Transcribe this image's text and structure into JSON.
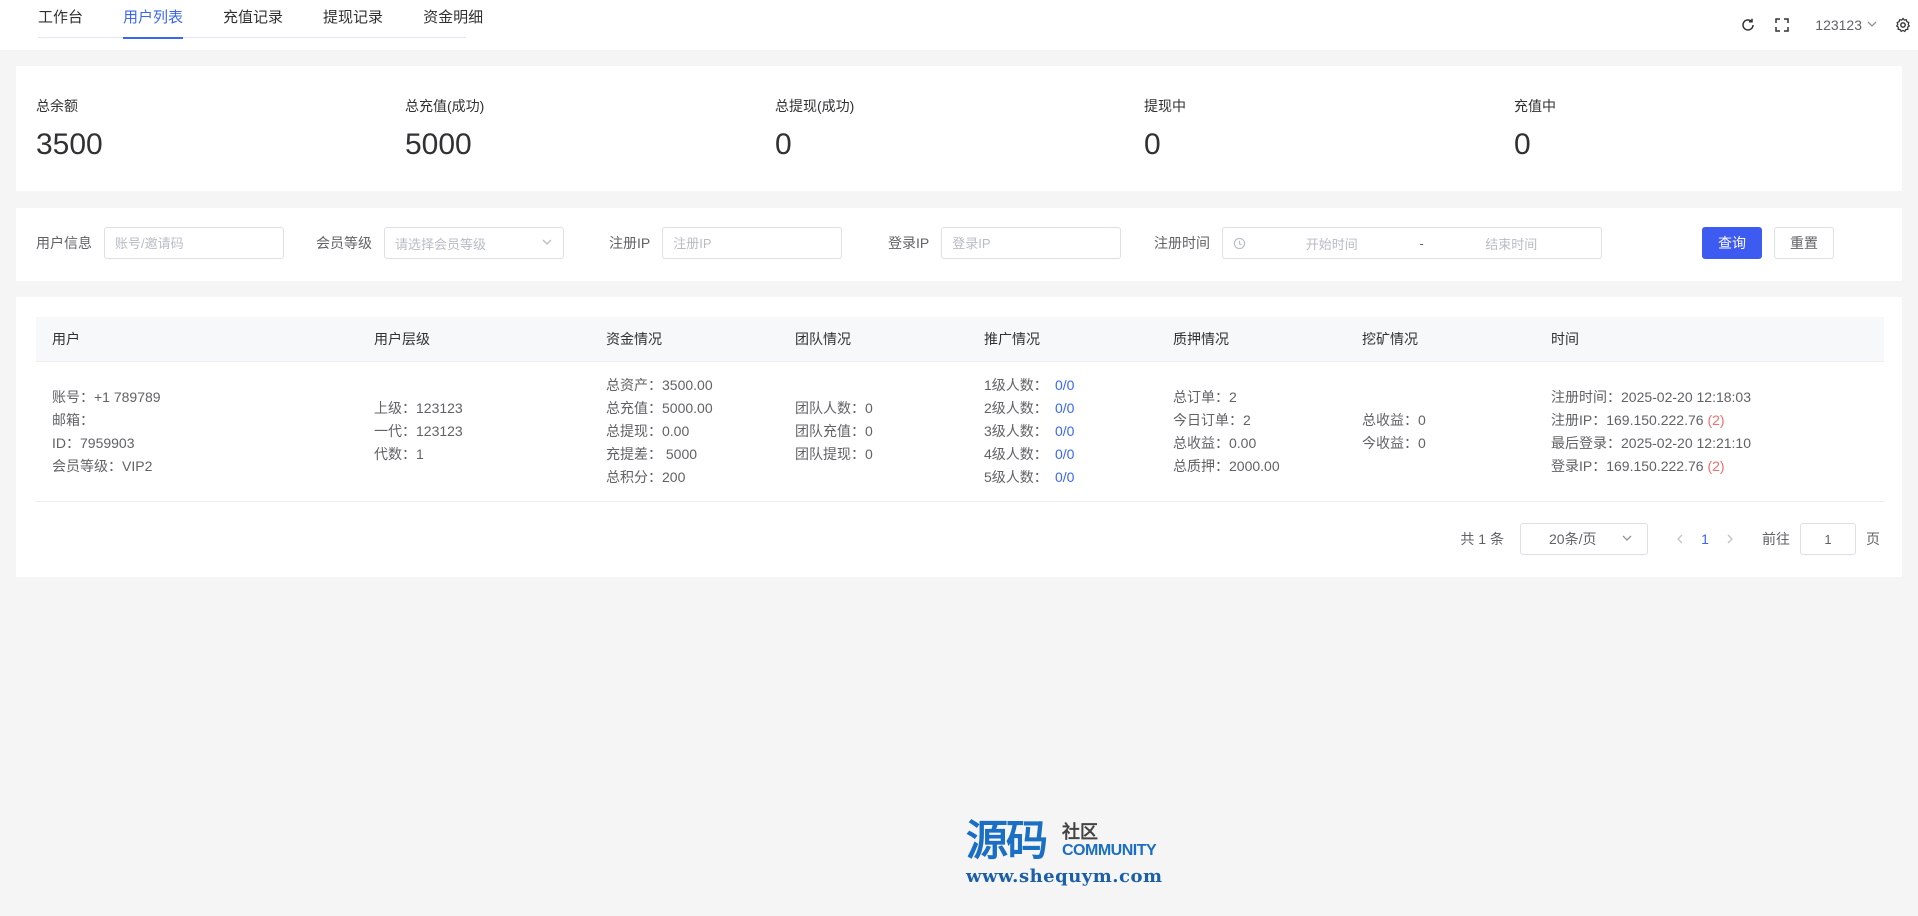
{
  "nav": {
    "tabs": [
      "工作台",
      "用户列表",
      "充值记录",
      "提现记录",
      "资金明细"
    ],
    "active_tab": "用户列表",
    "user": "123123",
    "icons": [
      "refresh-icon",
      "fullscreen-icon",
      "chevron-down-icon",
      "gear-icon"
    ]
  },
  "stats": [
    {
      "label": "总余额",
      "value": "3500"
    },
    {
      "label": "总充值(成功)",
      "value": "5000"
    },
    {
      "label": "总提现(成功)",
      "value": "0"
    },
    {
      "label": "提现中",
      "value": "0"
    },
    {
      "label": "充值中",
      "value": "0"
    }
  ],
  "filter": {
    "user_info_label": "用户信息",
    "user_info_placeholder": "账号/邀请码",
    "level_label": "会员等级",
    "level_placeholder": "请选择会员等级",
    "reg_ip_label": "注册IP",
    "reg_ip_placeholder": "注册IP",
    "login_ip_label": "登录IP",
    "login_ip_placeholder": "登录IP",
    "reg_time_label": "注册时间",
    "start_placeholder": "开始时间",
    "range_sep": "-",
    "end_placeholder": "结束时间",
    "query_button": "查询",
    "reset_button": "重置"
  },
  "table": {
    "headers": [
      "用户",
      "用户层级",
      "资金情况",
      "团队情况",
      "推广情况",
      "质押情况",
      "挖矿情况",
      "时间"
    ],
    "row": {
      "user": [
        "账号：+1 789789",
        "邮箱：",
        "ID：7959903",
        "会员等级：VIP2"
      ],
      "level": [
        "上级：123123",
        "一代：123123",
        "代数：1"
      ],
      "funds": [
        "总资产：3500.00",
        "总充值：5000.00",
        "总提现：0.00",
        "充提差： 5000",
        "总积分：200"
      ],
      "team": [
        "团队人数：0",
        "团队充值：0",
        "团队提现：0"
      ],
      "promo": [
        {
          "label": "1级人数：",
          "value": "0/0"
        },
        {
          "label": "2级人数：",
          "value": "0/0"
        },
        {
          "label": "3级人数：",
          "value": "0/0"
        },
        {
          "label": "4级人数：",
          "value": "0/0"
        },
        {
          "label": "5级人数：",
          "value": "0/0"
        }
      ],
      "pledge": [
        "总订单：2",
        "今日订单：2",
        "总收益：0.00",
        "总质押：2000.00"
      ],
      "mining": [
        "总收益：0",
        "今收益：0"
      ],
      "time": {
        "reg_time": "注册时间：2025-02-20 12:18:03",
        "reg_ip": "注册IP：169.150.222.76 ",
        "reg_ip_count": "(2)",
        "last_login": "最后登录：2025-02-20 12:21:10",
        "login_ip": "登录IP：169.150.222.76 ",
        "login_ip_count": "(2)"
      }
    }
  },
  "pagination": {
    "total": "共 1 条",
    "page_size": "20条/页",
    "current_page": "1",
    "goto_label": "前往",
    "goto_value": "1",
    "page_suffix": "页"
  },
  "watermark": {
    "big": "源码",
    "small": "社区",
    "community": "COMMUNITY",
    "url": "www.shequym.com"
  }
}
